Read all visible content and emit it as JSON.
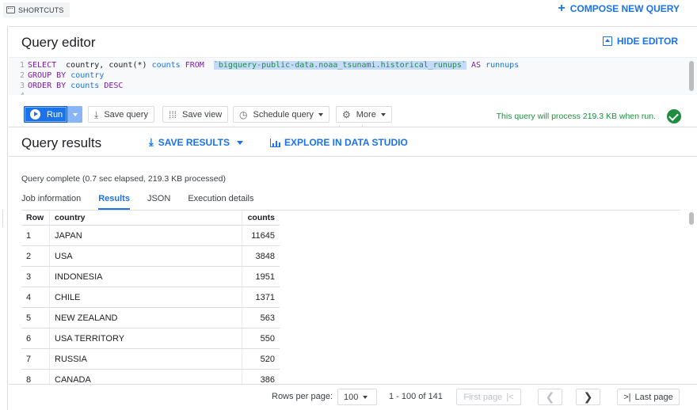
{
  "topbar": {
    "shortcuts_label": "SHORTCUTS",
    "compose_label": "COMPOSE NEW QUERY"
  },
  "editor": {
    "title": "Query editor",
    "hide_label": "HIDE EDITOR",
    "lines": [
      {
        "n": "1",
        "parts": [
          {
            "t": "SELECT",
            "c": "kw"
          },
          {
            "t": "  country, ",
            "c": "id"
          },
          {
            "t": "count",
            "c": "fn"
          },
          {
            "t": "(*) ",
            "c": "id"
          },
          {
            "t": "counts",
            "c": "kwb"
          },
          {
            "t": " ",
            "c": "id"
          },
          {
            "t": "FROM",
            "c": "kw"
          },
          {
            "t": "  ",
            "c": "id"
          },
          {
            "t": "`bigquery-public-data.noaa_tsunami.historical_runups`",
            "c": "str"
          },
          {
            "t": " ",
            "c": "id"
          },
          {
            "t": "AS",
            "c": "kw"
          },
          {
            "t": " ",
            "c": "id"
          },
          {
            "t": "runnups",
            "c": "kwb"
          }
        ]
      },
      {
        "n": "2",
        "parts": [
          {
            "t": "GROUP BY",
            "c": "kw"
          },
          {
            "t": " ",
            "c": "id"
          },
          {
            "t": "country",
            "c": "kwb"
          }
        ]
      },
      {
        "n": "3",
        "parts": [
          {
            "t": "ORDER BY",
            "c": "kw"
          },
          {
            "t": " ",
            "c": "id"
          },
          {
            "t": "counts",
            "c": "kwb"
          },
          {
            "t": " ",
            "c": "id"
          },
          {
            "t": "DESC",
            "c": "kw"
          }
        ]
      },
      {
        "n": "4",
        "parts": []
      }
    ]
  },
  "toolbar": {
    "run_label": "Run",
    "save_query_label": "Save query",
    "save_view_label": "Save view",
    "schedule_label": "Schedule query",
    "more_label": "More",
    "process_msg": "This query will process 219.3 KB when run."
  },
  "results": {
    "title": "Query results",
    "save_results_label": "SAVE RESULTS",
    "explore_label": "EXPLORE IN DATA STUDIO",
    "status": "Query complete (0.7 sec elapsed, 219.3 KB processed)",
    "tabs": [
      "Job information",
      "Results",
      "JSON",
      "Execution details"
    ],
    "active_tab": 1,
    "columns": [
      "Row",
      "country",
      "counts"
    ],
    "rows": [
      [
        "1",
        "JAPAN",
        "11645"
      ],
      [
        "2",
        "USA",
        "3848"
      ],
      [
        "3",
        "INDONESIA",
        "1951"
      ],
      [
        "4",
        "CHILE",
        "1371"
      ],
      [
        "5",
        "NEW ZEALAND",
        "563"
      ],
      [
        "6",
        "USA TERRITORY",
        "550"
      ],
      [
        "7",
        "RUSSIA",
        "520"
      ],
      [
        "8",
        "CANADA",
        "386"
      ]
    ]
  },
  "pager": {
    "rows_per_page_label": "Rows per page:",
    "rows_per_page_value": "100",
    "range": "1 - 100 of 141",
    "first_label": "First page",
    "last_label": "Last page"
  },
  "colors": {
    "accent": "#1a73e8",
    "success": "#1e8e3e",
    "border": "#dadce0"
  }
}
